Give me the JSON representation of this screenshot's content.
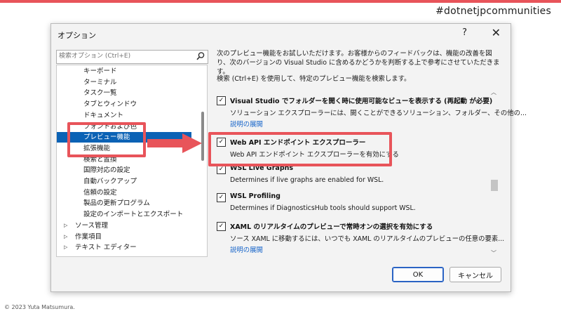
{
  "slide": {
    "hashtag": "#dotnetjpcommunities",
    "copyright": "© 2023 Yuta Matsumura."
  },
  "dialog": {
    "title": "オプション",
    "help": "?",
    "close": "✕",
    "search": {
      "placeholder": "検索オプション (Ctrl+E)"
    },
    "tree": [
      {
        "label": "キーボード",
        "level": "sub"
      },
      {
        "label": "ターミナル",
        "level": "sub"
      },
      {
        "label": "タスク一覧",
        "level": "sub"
      },
      {
        "label": "タブとウィンドウ",
        "level": "sub"
      },
      {
        "label": "ドキュメント",
        "level": "sub"
      },
      {
        "label": "フォントおよび色",
        "level": "sub"
      },
      {
        "label": "プレビュー機能",
        "level": "sub",
        "selected": true
      },
      {
        "label": "拡張機能",
        "level": "sub"
      },
      {
        "label": "検索と置換",
        "level": "sub"
      },
      {
        "label": "国際対応の設定",
        "level": "sub"
      },
      {
        "label": "自動バックアップ",
        "level": "sub"
      },
      {
        "label": "信頼の設定",
        "level": "sub"
      },
      {
        "label": "製品の更新プログラム",
        "level": "sub"
      },
      {
        "label": "設定のインポートとエクスポート",
        "level": "sub"
      },
      {
        "label": "ソース管理",
        "level": "top"
      },
      {
        "label": "作業項目",
        "level": "top"
      },
      {
        "label": "テキスト エディター",
        "level": "top"
      }
    ],
    "description": "次のプレビュー機能をお試しいただけます。お客様からのフィードバックは、機能の改善を図り、次のバージョンの Visual Studio に含めるかどうかを判断する上で参考にさせていただきます。",
    "search_hint": "検索 (Ctrl+E) を使用して、特定のプレビュー機能を検索します。",
    "features": [
      {
        "checked": true,
        "title": "Visual Studio でフォルダーを開く時に使用可能なビューを表示する (再起動 が必要)",
        "desc": "ソリューション エクスプローラーには、開くことができるソリューション、フォルダー、その他の...",
        "link": "説明の展開"
      },
      {
        "checked": true,
        "title": "Web API エンドポイント エクスプローラー",
        "desc": "Web API エンドポイント エクスプローラーを有効にする",
        "link": ""
      },
      {
        "checked": true,
        "title": "WSL Live Graphs",
        "desc": "Determines if live graphs are enabled for WSL.",
        "link": ""
      },
      {
        "checked": true,
        "title": "WSL Profiling",
        "desc": "Determines if DiagnosticsHub tools should support WSL.",
        "link": ""
      },
      {
        "checked": true,
        "title": "XAML のリアルタイムのプレビューで常時オンの選択を有効にする",
        "desc": "ソース XAML に移動するには、いつでも XAML のリアルタイムのプレビューの任意の要素...",
        "link": "説明の展開"
      }
    ],
    "ok_label": "OK",
    "cancel_label": "キャンセル"
  },
  "icons": {
    "search": "search-icon",
    "checkbox": "check-icon",
    "expand": "chevron-right-icon",
    "callout": "arrow-right-icon"
  },
  "colors": {
    "accent_red": "#e8545a",
    "selection_blue": "#0b62b5",
    "link_blue": "#1463c9"
  }
}
